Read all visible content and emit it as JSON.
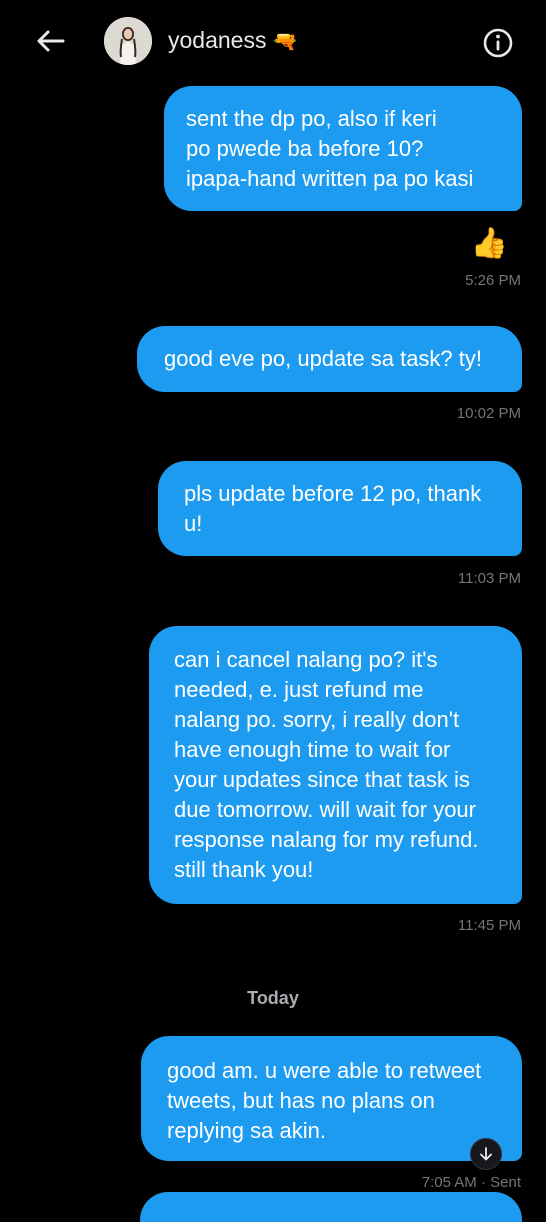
{
  "header": {
    "username": "yodaness",
    "emoji": "🔫",
    "back_icon": "arrow-left-icon",
    "info_icon": "info-circle-icon"
  },
  "messages": [
    {
      "lines": [
        "sent the dp po, also if keri",
        "po pwede ba before 10?",
        "ipapa-hand written pa po kasi"
      ],
      "reaction": "👍",
      "time": "5:26 PM"
    },
    {
      "lines": [
        "good eve po, update sa task? ty!"
      ],
      "time": "10:02 PM"
    },
    {
      "lines": [
        "pls update before 12 po, thank",
        "u!"
      ],
      "time": "11:03 PM"
    },
    {
      "lines": [
        "can i cancel nalang po? it's",
        "needed, e. just refund me",
        "nalang po. sorry, i really don't",
        "have enough time to wait for",
        "your updates since that task is",
        "due tomorrow. will wait for your",
        "response nalang for my refund.",
        "still thank you!"
      ],
      "time": "11:45 PM"
    },
    {
      "lines": [
        "good am. u were able to retweet",
        "tweets, but has no plans on",
        "replying sa akin."
      ],
      "time": "7:05 AM · Sent"
    }
  ],
  "day_separator": "Today",
  "colors": {
    "bubble": "#1d9bf0",
    "background": "#000000",
    "timestamp": "#71767b"
  }
}
